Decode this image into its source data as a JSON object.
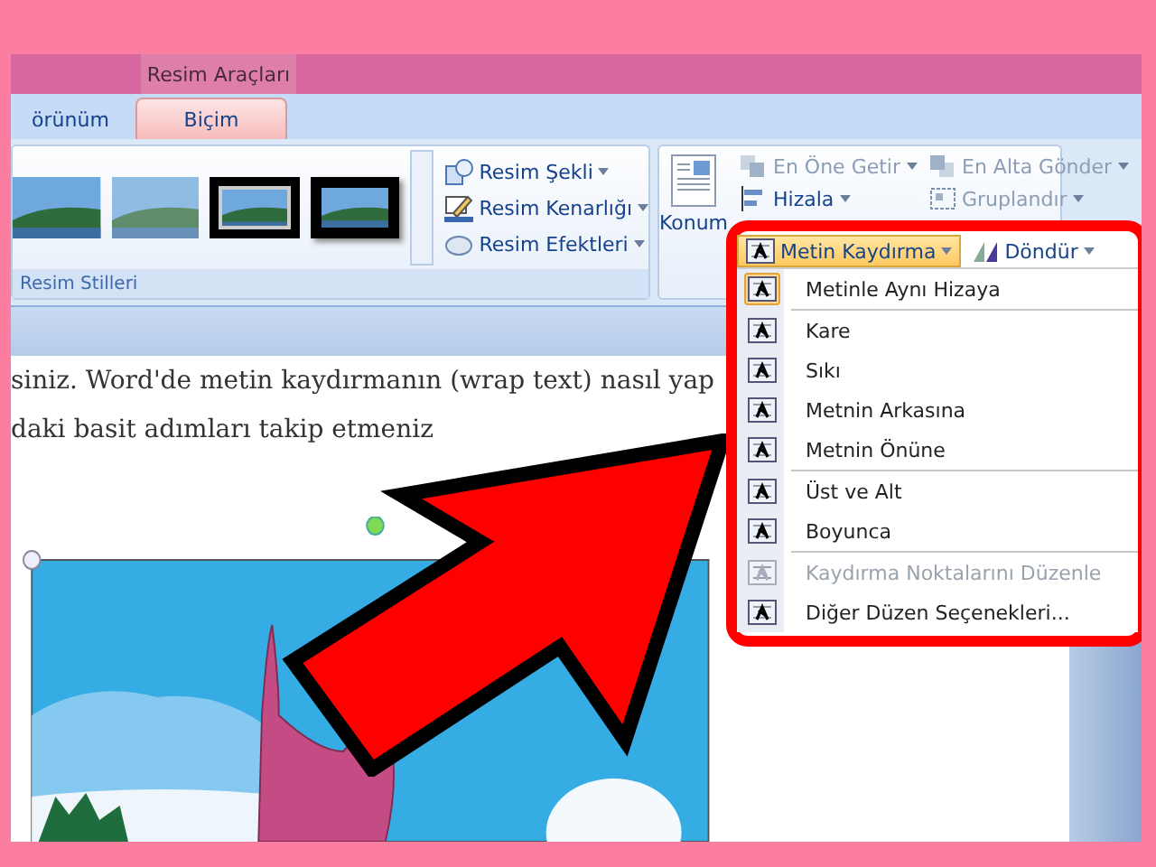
{
  "contextual_tab": {
    "title": "Resim Araçları"
  },
  "tabs": [
    {
      "label": "örünüm",
      "selected": false
    },
    {
      "label": "Biçim",
      "selected": true
    }
  ],
  "ribbon": {
    "picture_styles": {
      "title": "Resim Stilleri",
      "thumbnails": [
        {
          "kind": "soft-edge",
          "selected": false
        },
        {
          "kind": "faded",
          "selected": false
        },
        {
          "kind": "white-frame",
          "selected": false
        },
        {
          "kind": "black-frame",
          "selected": false
        }
      ],
      "commands": [
        {
          "kind": "shape",
          "label": "Resim Şekli"
        },
        {
          "kind": "border",
          "label": "Resim Kenarlığı"
        },
        {
          "kind": "effects",
          "label": "Resim Efektleri"
        }
      ]
    },
    "arrange": {
      "position_button": "Konum",
      "commands": [
        {
          "kind": "front",
          "label": "En Öne Getir",
          "disabled": true
        },
        {
          "kind": "back",
          "label": "En Alta Gönder",
          "disabled": true
        },
        {
          "kind": "align",
          "label": "Hizala",
          "disabled": false
        },
        {
          "kind": "group",
          "label": "Gruplandır",
          "disabled": true
        }
      ],
      "wrap_button": {
        "label": "Metin Kaydırma",
        "selected": true
      },
      "rotate_button": {
        "label": "Döndür",
        "selected": false
      }
    }
  },
  "document": {
    "lines": [
      "siniz. Word'de metin kaydırmanın (wrap text) nasıl yap",
      "daki basit adımları takip etmeniz"
    ]
  },
  "wrap_menu": {
    "groups": [
      [
        {
          "label": "Metinle Aynı Hizaya",
          "selected": true,
          "disabled": false
        }
      ],
      [
        {
          "label": "Kare",
          "selected": false,
          "disabled": false
        },
        {
          "label": "Sıkı",
          "selected": false,
          "disabled": false
        },
        {
          "label": "Metnin Arkasına",
          "selected": false,
          "disabled": false
        },
        {
          "label": "Metnin Önüne",
          "selected": false,
          "disabled": false
        }
      ],
      [
        {
          "label": "Üst ve Alt",
          "selected": false,
          "disabled": false
        },
        {
          "label": "Boyunca",
          "selected": false,
          "disabled": false
        }
      ],
      [
        {
          "label": "Kaydırma Noktalarını Düzenle",
          "selected": false,
          "disabled": true
        },
        {
          "label": "Diğer Düzen Seçenekleri...",
          "selected": false,
          "disabled": false
        }
      ]
    ]
  }
}
